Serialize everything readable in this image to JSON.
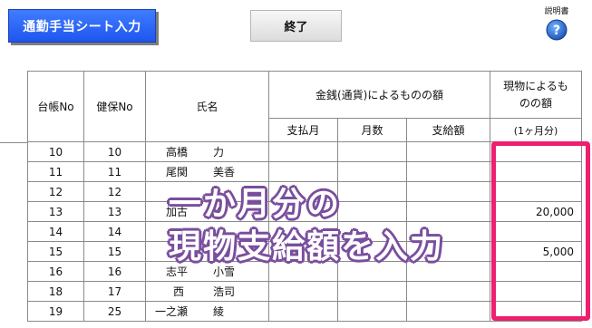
{
  "toolbar": {
    "title": "通勤手当シート入力",
    "end_label": "終了",
    "help_label": "説明書",
    "help_icon_glyph": "?"
  },
  "table": {
    "headers": {
      "ledger_no": "台帳No",
      "insurance_no": "健保No",
      "name": "氏名",
      "money_group": "金銭(通貨)によるものの額",
      "payment_month": "支払月",
      "months": "月数",
      "pay_amount": "支給額",
      "goods_line1": "現物によるも",
      "goods_line2": "のの額",
      "goods_unit": "(1ヶ月分)"
    },
    "rows": [
      {
        "ledger": "10",
        "insurance": "10",
        "surname": "高橋",
        "given": "力",
        "goods": ""
      },
      {
        "ledger": "11",
        "insurance": "11",
        "surname": "尾関",
        "given": "美香",
        "goods": ""
      },
      {
        "ledger": "12",
        "insurance": "12",
        "surname": "",
        "given": "",
        "goods": ""
      },
      {
        "ledger": "13",
        "insurance": "13",
        "surname": "加古",
        "given": "修",
        "goods": "20,000"
      },
      {
        "ledger": "14",
        "insurance": "14",
        "surname": "",
        "given": "",
        "goods": ""
      },
      {
        "ledger": "15",
        "insurance": "15",
        "surname": "",
        "given": "",
        "goods": "5,000"
      },
      {
        "ledger": "16",
        "insurance": "16",
        "surname": "志平",
        "given": "小雪",
        "goods": ""
      },
      {
        "ledger": "18",
        "insurance": "17",
        "surname": "西",
        "given": "浩司",
        "goods": ""
      },
      {
        "ledger": "19",
        "insurance": "25",
        "surname": "一之瀬",
        "given": "綾",
        "goods": ""
      }
    ]
  },
  "overlay": {
    "line1": "一か月分の",
    "line2": "現物支給額を入力"
  },
  "colors": {
    "title_button": "#2a5ef5",
    "highlight_border": "#ee1f6e",
    "overlay_outline": "#7a4f9e"
  }
}
